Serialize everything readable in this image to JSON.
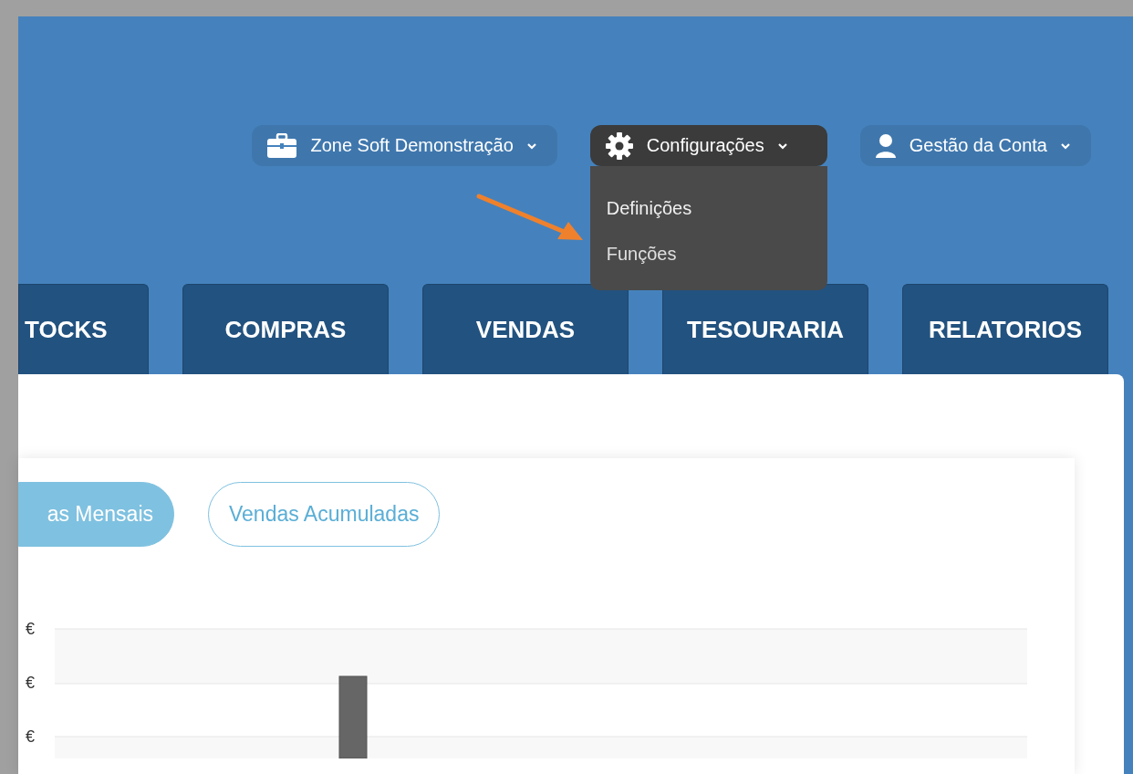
{
  "header_menus": [
    {
      "label": "Zone Soft Demonstração",
      "kind": "briefcase",
      "expanded": false
    },
    {
      "label": "Configurações",
      "kind": "gear",
      "expanded": true,
      "items": [
        {
          "label": "Definições",
          "pointed": false
        },
        {
          "label": "Funções",
          "pointed": true
        }
      ]
    },
    {
      "label": "Gestão da Conta",
      "kind": "user",
      "expanded": false
    }
  ],
  "tabs": [
    {
      "label": "TOCKS"
    },
    {
      "label": "COMPRAS"
    },
    {
      "label": "VENDAS"
    },
    {
      "label": "TESOURARIA"
    },
    {
      "label": "RELATORIOS"
    }
  ],
  "chart_toggle": [
    {
      "label": "as Mensais",
      "selected": true
    },
    {
      "label": "Vendas Acumuladas",
      "selected": false
    }
  ],
  "chart": {
    "axis_labels": [
      "€",
      "€",
      "€"
    ]
  }
}
